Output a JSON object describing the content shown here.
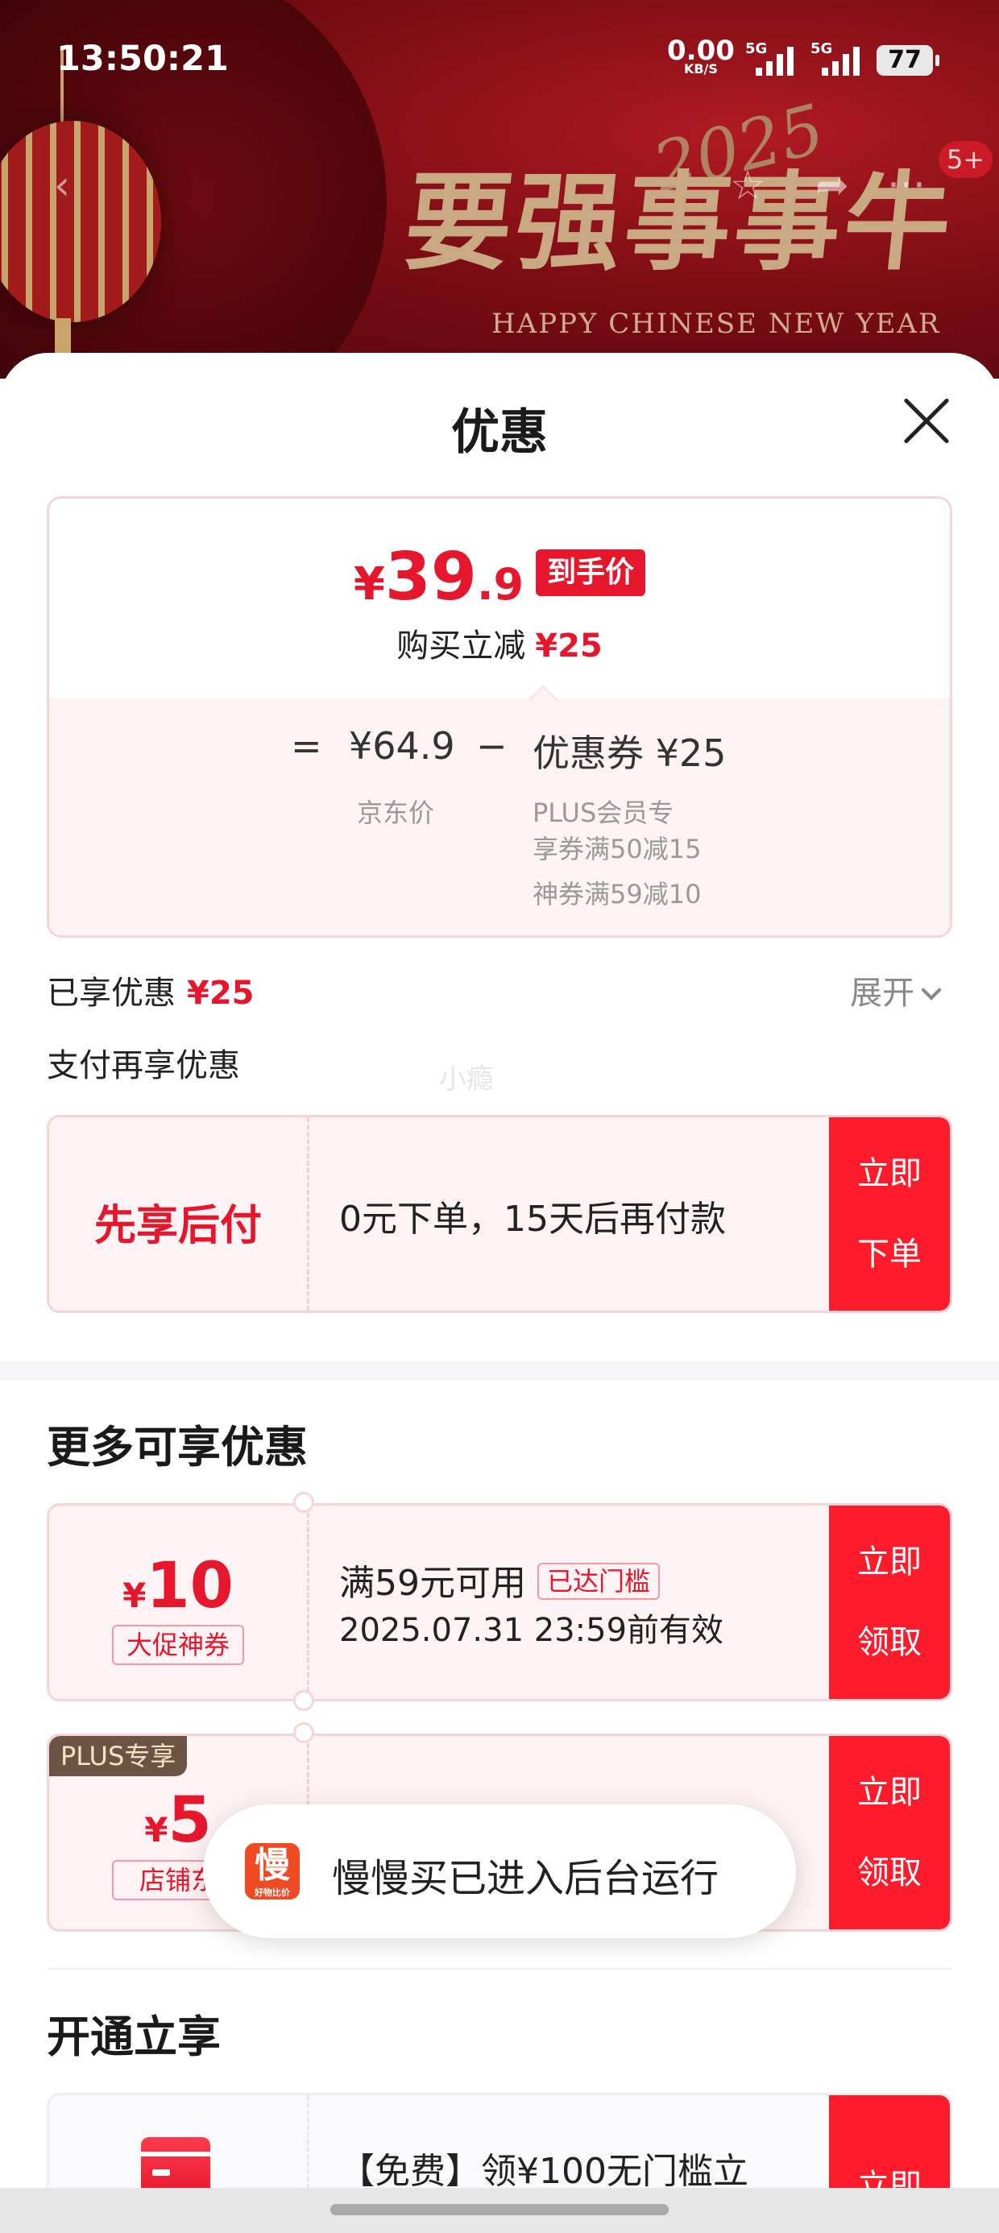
{
  "status_bar": {
    "time": "13:50:21",
    "net_speed": "0.00",
    "net_unit": "KB/S",
    "sim1": "5G",
    "sim2": "5G",
    "battery": "77"
  },
  "banner": {
    "slogan": "要强事事牛",
    "year_art": "2025",
    "subtitle": "HAPPY CHINESE NEW YEAR",
    "message_badge": "5+",
    "icons": [
      "back-icon",
      "star-icon",
      "share-icon",
      "more-icon"
    ]
  },
  "sheet": {
    "title": "优惠",
    "price_card": {
      "currency": "¥",
      "price_int": "39",
      "price_dec": ".9",
      "tag": "到手价",
      "discount_label": "购买立减",
      "discount_value": "¥25",
      "equals": "=",
      "jd_price": "¥64.9",
      "minus": "−",
      "coupon_label": "优惠券 ¥25",
      "jd_price_label": "京东价",
      "coupon_detail_1": "PLUS会员专",
      "coupon_detail_2": "享券满50减15",
      "coupon_detail_3": "神券满59减10"
    },
    "enjoyed_label": "已享优惠",
    "enjoyed_value": "¥25",
    "expand_label": "展开",
    "pay_more_label": "支付再享优惠",
    "watermark": "小瘾",
    "bnpl": {
      "title": "先享后付",
      "desc": "0元下单，15天后再付款",
      "cta_1": "立即",
      "cta_2": "下单"
    },
    "more_section_title": "更多可享优惠",
    "coupons": [
      {
        "currency": "¥",
        "amount": "10",
        "type": "大促神券",
        "condition": "满59元可用",
        "badge": "已达门槛",
        "validity": "2025.07.31 23:59前有效",
        "cta_1": "立即",
        "cta_2": "领取"
      },
      {
        "plus_tag": "PLUS专享",
        "currency": "¥",
        "amount": "5",
        "type": "店铺东",
        "cta_1": "立即",
        "cta_2": "领取"
      }
    ],
    "open_section_title": "开通立享",
    "open_offer": {
      "desc": "【免费】领¥100无门槛立",
      "cta": "立即"
    }
  },
  "toast": {
    "logo_char": "慢",
    "logo_sub": "好物比价",
    "text": "慢慢买已进入后台运行"
  },
  "colors": {
    "accent_red": "#e6162d",
    "cta_red": "#fd1b2c",
    "card_pink": "#fdf3f4",
    "banner_red": "#7d0d14"
  }
}
